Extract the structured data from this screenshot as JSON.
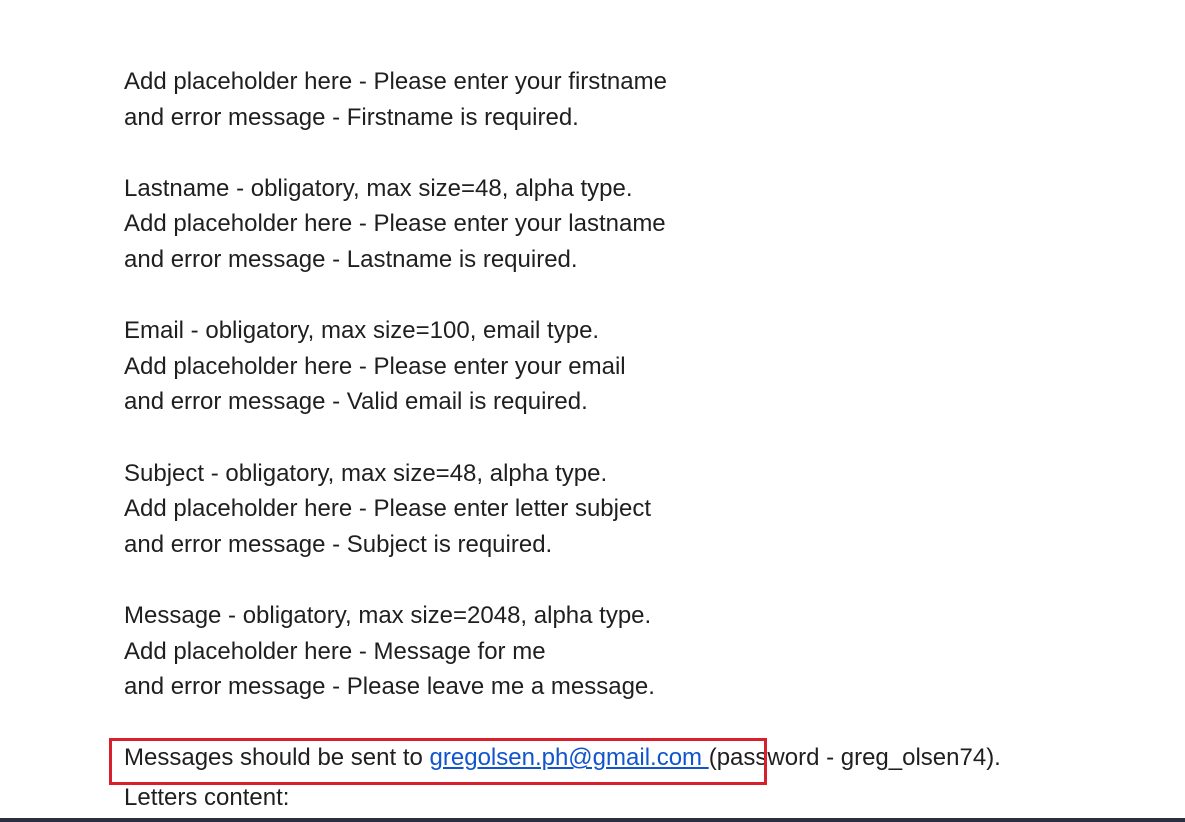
{
  "document": {
    "firstname": {
      "placeholder_line": "Add placeholder here - Please enter your firstname",
      "error_line": "and error message - Firstname is required."
    },
    "lastname": {
      "spec_line": "Lastname - obligatory, max size=48, alpha type.",
      "placeholder_line": "Add placeholder here - Please enter your lastname",
      "error_line": "and error message - Lastname is required."
    },
    "email": {
      "spec_line": "Email - obligatory, max size=100, email type.",
      "placeholder_line": "Add placeholder here - Please enter your email",
      "error_line": "and error message - Valid email is required."
    },
    "subject": {
      "spec_line": "Subject - obligatory, max size=48, alpha type.",
      "placeholder_line": "Add placeholder here - Please enter letter subject",
      "error_line": "and error message - Subject is required."
    },
    "message": {
      "spec_line": "Message - obligatory, max size=2048, alpha type.",
      "placeholder_line": "Add placeholder here - Message for me",
      "error_line": "and error message - Please leave me a message."
    },
    "send_to": {
      "prefix": "Messages should be sent to ",
      "email_link": "gregolsen.ph@gmail.com ",
      "suffix": "(password - greg_olsen74)."
    },
    "letters_content": "Letters content:"
  },
  "colors": {
    "link": "#1155cc",
    "highlight_border": "#d7202b",
    "text": "#1f1f1f"
  }
}
